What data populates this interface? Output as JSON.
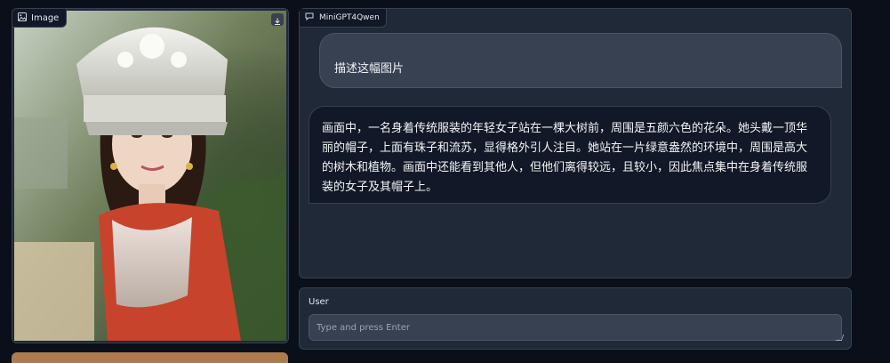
{
  "image_panel": {
    "label": "Image",
    "icon": "image-icon",
    "download_icon": "download-icon"
  },
  "chatbot": {
    "label": "MiniGPT4Qwen",
    "icon": "chat-icon",
    "messages": [
      {
        "role": "user",
        "text": "描述这幅图片"
      },
      {
        "role": "bot",
        "text": "画面中，一名身着传统服装的年轻女子站在一棵大树前，周围是五颜六色的花朵。她头戴一顶华丽的帽子，上面有珠子和流苏，显得格外引人注目。她站在一片绿意盎然的环境中，周围是高大的树木和植物。画面中还能看到其他人，但他们离得较远，且较小，因此焦点集中在身着传统服装的女子及其帽子上。"
      }
    ]
  },
  "input": {
    "label": "User",
    "placeholder": "Type and press Enter",
    "value": ""
  },
  "colors": {
    "background": "#0b0f19",
    "panel": "#1f2937",
    "border": "#374151",
    "bottom_strip": "#b07a4f"
  }
}
